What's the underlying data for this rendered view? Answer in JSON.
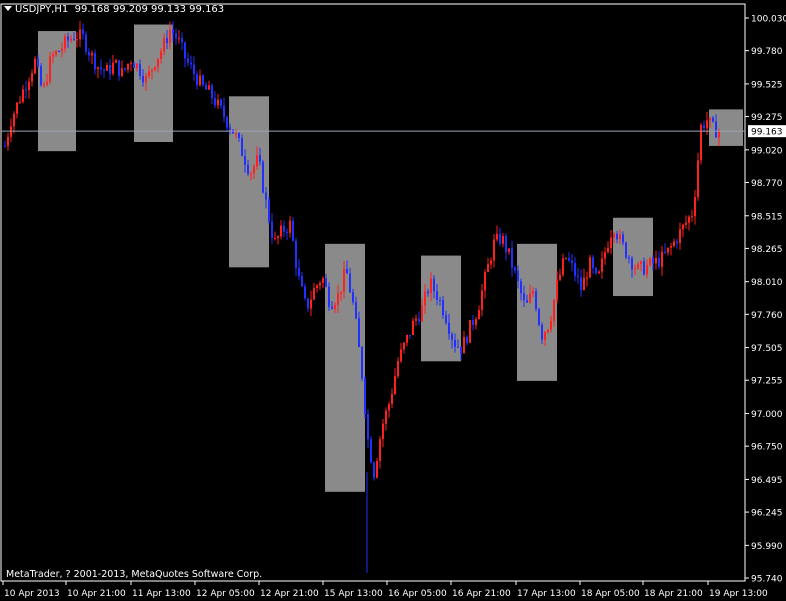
{
  "header": {
    "symbol": "USDJPY,H1",
    "ohlc": "99.168 99.209 99.133 99.163"
  },
  "footer": {
    "copyright": "MetaTrader, ? 2001-2013, MetaQuotes Software Corp."
  },
  "chart_data": {
    "type": "candlestick",
    "bid_label": "99.163",
    "bid_value": 99.163,
    "ylim": [
      95.74,
      100.03
    ],
    "y_ticks": [
      "100.030",
      "99.780",
      "99.525",
      "99.275",
      "99.020",
      "98.770",
      "98.515",
      "98.265",
      "98.010",
      "97.760",
      "97.505",
      "97.255",
      "97.000",
      "96.750",
      "96.495",
      "96.245",
      "95.990",
      "95.740"
    ],
    "x_ticks": [
      "10 Apr 2013",
      "10 Apr 21:00",
      "11 Apr 13:00",
      "12 Apr 05:00",
      "12 Apr 21:00",
      "15 Apr 13:00",
      "16 Apr 05:00",
      "16 Apr 21:00",
      "17 Apr 13:00",
      "18 Apr 05:00",
      "18 Apr 21:00",
      "19 Apr 13:00"
    ],
    "price_path": [
      [
        0,
        99.05
      ],
      [
        6,
        99.25
      ],
      [
        14,
        99.4
      ],
      [
        22,
        99.55
      ],
      [
        30,
        99.7
      ],
      [
        38,
        99.45
      ],
      [
        46,
        99.72
      ],
      [
        54,
        99.78
      ],
      [
        62,
        99.85
      ],
      [
        70,
        99.9
      ],
      [
        78,
        99.88
      ],
      [
        86,
        99.75
      ],
      [
        94,
        99.65
      ],
      [
        102,
        99.62
      ],
      [
        110,
        99.68
      ],
      [
        118,
        99.6
      ],
      [
        126,
        99.72
      ],
      [
        134,
        99.65
      ],
      [
        142,
        99.55
      ],
      [
        150,
        99.7
      ],
      [
        158,
        99.8
      ],
      [
        166,
        99.95
      ],
      [
        174,
        99.85
      ],
      [
        182,
        99.7
      ],
      [
        190,
        99.6
      ],
      [
        198,
        99.5
      ],
      [
        206,
        99.45
      ],
      [
        214,
        99.35
      ],
      [
        222,
        99.25
      ],
      [
        230,
        99.15
      ],
      [
        238,
        99.0
      ],
      [
        246,
        98.85
      ],
      [
        254,
        98.95
      ],
      [
        262,
        98.6
      ],
      [
        270,
        98.3
      ],
      [
        278,
        98.4
      ],
      [
        286,
        98.45
      ],
      [
        294,
        98.05
      ],
      [
        302,
        97.8
      ],
      [
        310,
        97.95
      ],
      [
        318,
        98.05
      ],
      [
        326,
        97.85
      ],
      [
        334,
        97.9
      ],
      [
        342,
        98.1
      ],
      [
        350,
        97.8
      ],
      [
        358,
        97.3
      ],
      [
        364,
        96.8
      ],
      [
        370,
        96.55
      ],
      [
        378,
        96.9
      ],
      [
        386,
        97.1
      ],
      [
        394,
        97.4
      ],
      [
        402,
        97.55
      ],
      [
        410,
        97.7
      ],
      [
        418,
        97.8
      ],
      [
        426,
        98.0
      ],
      [
        434,
        97.9
      ],
      [
        442,
        97.75
      ],
      [
        450,
        97.55
      ],
      [
        458,
        97.5
      ],
      [
        466,
        97.65
      ],
      [
        474,
        97.8
      ],
      [
        482,
        98.05
      ],
      [
        490,
        98.3
      ],
      [
        498,
        98.35
      ],
      [
        506,
        98.2
      ],
      [
        514,
        98.0
      ],
      [
        522,
        97.8
      ],
      [
        530,
        97.95
      ],
      [
        538,
        97.6
      ],
      [
        546,
        97.7
      ],
      [
        554,
        98.0
      ],
      [
        562,
        98.2
      ],
      [
        570,
        98.1
      ],
      [
        578,
        97.95
      ],
      [
        586,
        98.15
      ],
      [
        594,
        98.0
      ],
      [
        602,
        98.25
      ],
      [
        610,
        98.45
      ],
      [
        618,
        98.3
      ],
      [
        626,
        98.2
      ],
      [
        634,
        98.1
      ],
      [
        642,
        98.12
      ],
      [
        650,
        98.15
      ],
      [
        658,
        98.18
      ],
      [
        666,
        98.25
      ],
      [
        674,
        98.35
      ],
      [
        682,
        98.45
      ],
      [
        690,
        98.55
      ],
      [
        698,
        99.2
      ],
      [
        704,
        99.25
      ],
      [
        710,
        99.18
      ],
      [
        718,
        99.16
      ]
    ],
    "range_boxes": [
      {
        "x0": 0,
        "x1": 38,
        "low": 99.01,
        "high": 99.93
      },
      {
        "x0": 96,
        "x1": 135,
        "low": 99.08,
        "high": 99.98
      },
      {
        "x0": 191,
        "x1": 231,
        "low": 98.12,
        "high": 99.43
      },
      {
        "x0": 287,
        "x1": 327,
        "low": 96.4,
        "high": 98.3
      },
      {
        "x0": 383,
        "x1": 423,
        "low": 97.4,
        "high": 98.21
      },
      {
        "x0": 479,
        "x1": 519,
        "low": 97.25,
        "high": 98.3
      },
      {
        "x0": 575,
        "x1": 615,
        "low": 97.9,
        "high": 98.5
      },
      {
        "x0": 671,
        "x1": 705,
        "low": 99.05,
        "high": 99.33
      }
    ]
  }
}
